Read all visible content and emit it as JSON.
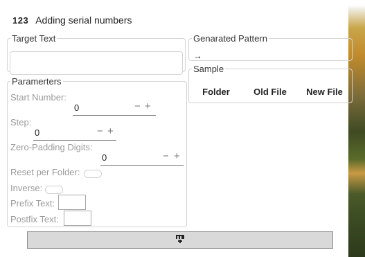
{
  "window": {
    "icon_text": "123",
    "title": "Adding serial numbers"
  },
  "target": {
    "legend": "Target Text",
    "value": ""
  },
  "pattern": {
    "legend": "Genarated Pattern",
    "text": "→"
  },
  "sample": {
    "legend": "Sample",
    "columns": [
      "Folder",
      "Old File",
      "New File"
    ]
  },
  "params": {
    "legend": "Paramerters",
    "start": {
      "label": "Start Number:",
      "value": "0"
    },
    "step": {
      "label": "Step:",
      "value": "0"
    },
    "padding": {
      "label": "Zero-Padding Digits:",
      "value": "0"
    },
    "reset_per_folder": {
      "label": "Reset per Folder:",
      "on": false
    },
    "inverse": {
      "label": "Inverse:",
      "on": false
    },
    "prefix": {
      "label": "Prefix Text:",
      "value": ""
    },
    "postfix": {
      "label": "Postfix Text:",
      "value": ""
    },
    "minus_glyph": "−",
    "plus_glyph": "+"
  },
  "run_button": {
    "icon": "serial-number-icon",
    "glyph": "᚛⊞᚜"
  }
}
